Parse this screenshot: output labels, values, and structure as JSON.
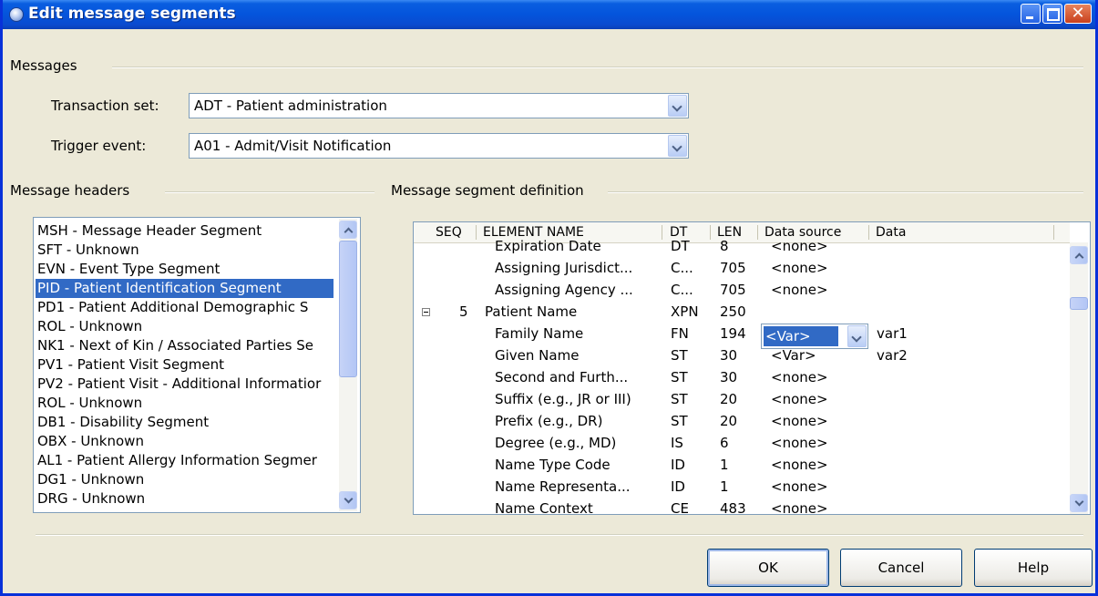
{
  "window": {
    "title": "Edit message segments"
  },
  "messages_group": {
    "label": "Messages",
    "transaction_set_label": "Transaction set:",
    "transaction_set_value": "ADT - Patient administration",
    "trigger_event_label": "Trigger event:",
    "trigger_event_value": "A01 - Admit/Visit Notification"
  },
  "headers_group": {
    "label": "Message headers",
    "items": [
      "MSH - Message Header Segment",
      "SFT - Unknown",
      "EVN - Event Type Segment",
      "PID - Patient Identification Segment",
      "PD1 - Patient Additional Demographic S",
      "ROL - Unknown",
      "NK1 - Next of Kin / Associated Parties Se",
      "PV1 - Patient Visit Segment",
      "PV2 - Patient Visit - Additional Informatior",
      "ROL - Unknown",
      "DB1 - Disability Segment",
      "OBX - Unknown",
      "AL1 - Patient Allergy Information Segmer",
      "DG1 - Unknown",
      "DRG - Unknown"
    ],
    "selected_index": 3
  },
  "definition_group": {
    "label": "Message segment definition",
    "columns": {
      "seq": "SEQ",
      "element": "ELEMENT NAME",
      "dt": "DT",
      "len": "LEN",
      "source": "Data source",
      "data": "Data"
    },
    "rows": [
      {
        "seq": "",
        "element": "Expiration Date",
        "dt": "DT",
        "len": "8",
        "source": "<none>",
        "data": "",
        "indent": true
      },
      {
        "seq": "",
        "element": "Assigning Jurisdict...",
        "dt": "C...",
        "len": "705",
        "source": "<none>",
        "data": "",
        "indent": true
      },
      {
        "seq": "",
        "element": "Assigning Agency ...",
        "dt": "C...",
        "len": "705",
        "source": "<none>",
        "data": "",
        "indent": true
      },
      {
        "seq": "5",
        "element": "Patient Name",
        "dt": "XPN",
        "len": "250",
        "source": "",
        "data": "",
        "indent": false
      },
      {
        "seq": "",
        "element": "Family Name",
        "dt": "FN",
        "len": "194",
        "source": "",
        "data": "var1",
        "indent": true
      },
      {
        "seq": "",
        "element": "Given Name",
        "dt": "ST",
        "len": "30",
        "source": "<Var>",
        "data": "var2",
        "indent": true
      },
      {
        "seq": "",
        "element": "Second and Furth...",
        "dt": "ST",
        "len": "30",
        "source": "<none>",
        "data": "",
        "indent": true
      },
      {
        "seq": "",
        "element": "Suffix (e.g., JR or III)",
        "dt": "ST",
        "len": "20",
        "source": "<none>",
        "data": "",
        "indent": true
      },
      {
        "seq": "",
        "element": "Prefix (e.g., DR)",
        "dt": "ST",
        "len": "20",
        "source": "<none>",
        "data": "",
        "indent": true
      },
      {
        "seq": "",
        "element": "Degree (e.g., MD)",
        "dt": "IS",
        "len": "6",
        "source": "<none>",
        "data": "",
        "indent": true
      },
      {
        "seq": "",
        "element": "Name Type Code",
        "dt": "ID",
        "len": "1",
        "source": "<none>",
        "data": "",
        "indent": true
      },
      {
        "seq": "",
        "element": "Name Representa...",
        "dt": "ID",
        "len": "1",
        "source": "<none>",
        "data": "",
        "indent": true
      },
      {
        "seq": "",
        "element": "Name Context",
        "dt": "CE",
        "len": "483",
        "source": "<none>",
        "data": "",
        "indent": true
      }
    ],
    "active_editor_value": "<Var>"
  },
  "buttons": {
    "ok": "OK",
    "cancel": "Cancel",
    "help": "Help"
  }
}
